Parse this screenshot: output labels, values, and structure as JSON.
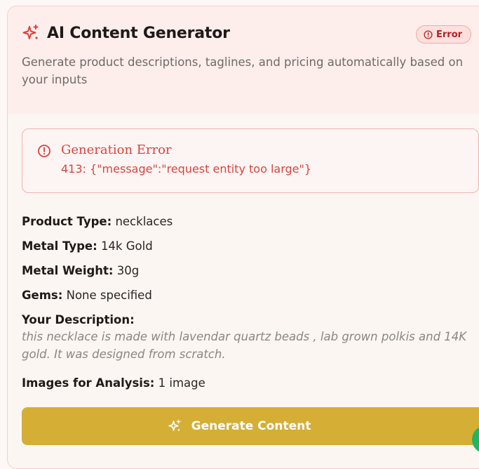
{
  "header": {
    "title": "AI Content Generator",
    "subtitle": "Generate product descriptions, taglines, and pricing automatically based on your inputs",
    "status_badge": "Error",
    "icon": "sparkles-icon"
  },
  "alert": {
    "title": "Generation Error",
    "message": "413: {\"message\":\"request entity too large\"}",
    "icon": "alert-circle-icon"
  },
  "fields": {
    "product_type": {
      "label": "Product Type:",
      "value": "necklaces"
    },
    "metal_type": {
      "label": "Metal Type:",
      "value": "14k Gold"
    },
    "metal_weight": {
      "label": "Metal Weight:",
      "value": "30g"
    },
    "gems": {
      "label": "Gems:",
      "value": "None specified"
    },
    "description": {
      "label": "Your Description:",
      "value": "this necklace is made with lavendar quartz beads , lab grown polkis and 14K gold. It was designed from scratch."
    },
    "images": {
      "label": "Images for Analysis:",
      "value": "1 image"
    }
  },
  "actions": {
    "generate_label": "Generate Content"
  },
  "colors": {
    "accent": "#d5ae35",
    "error": "#d9423f",
    "header_bg": "#fdeeec",
    "title_icon": "#e0403a"
  }
}
